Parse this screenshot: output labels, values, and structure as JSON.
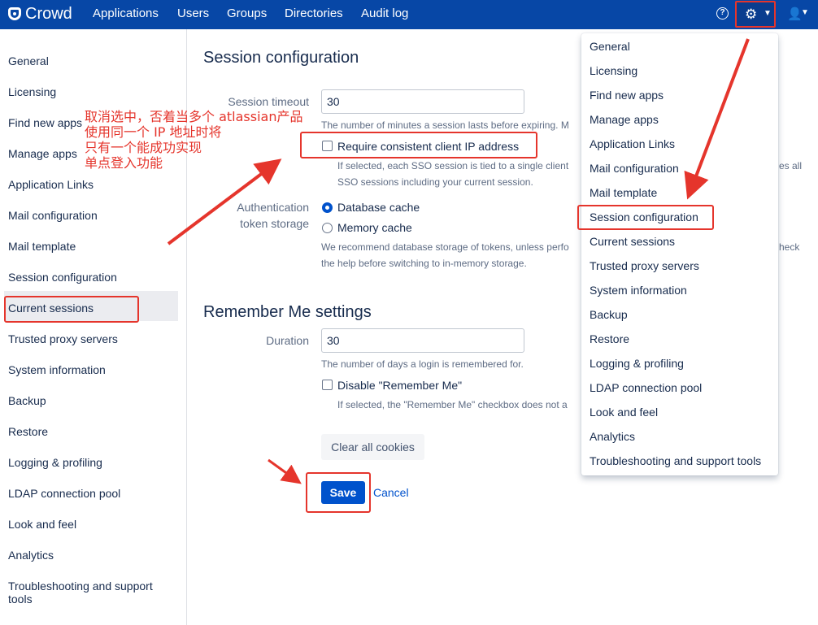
{
  "topnav": {
    "brand": "Crowd",
    "items": [
      "Applications",
      "Users",
      "Groups",
      "Directories",
      "Audit log"
    ],
    "help_glyph": "?",
    "icons": [
      "help-icon",
      "gear-icon",
      "user-icon"
    ]
  },
  "sidebar": {
    "items": [
      "General",
      "Licensing",
      "Find new apps",
      "Manage apps",
      "Application Links",
      "Mail configuration",
      "Mail template",
      "Session configuration",
      "Current sessions",
      "Trusted proxy servers",
      "System information",
      "Backup",
      "Restore",
      "Logging & profiling",
      "LDAP connection pool",
      "Look and feel",
      "Analytics",
      "Troubleshooting and support tools"
    ],
    "active": "Session configuration"
  },
  "session": {
    "title": "Session configuration",
    "timeout_label": "Session timeout",
    "timeout_value": "30",
    "timeout_help": "The number of minutes a session lasts before expiring. M",
    "ip_label": "Require consistent client IP address",
    "ip_help_1": "If selected, each SSO session is tied to a single client",
    "ip_help_1_tail": "es all",
    "ip_help_2": "SSO sessions including your current session.",
    "auth_label_1": "Authentication",
    "auth_label_2": "token storage",
    "opt_db": "Database cache",
    "opt_mem": "Memory cache",
    "storage_help_1": "We recommend database storage of tokens, unless perfo",
    "storage_help_1_tail": "heck",
    "storage_help_2": "the help before switching to in-memory storage."
  },
  "remember": {
    "title": "Remember Me settings",
    "duration_label": "Duration",
    "duration_value": "30",
    "duration_help": "The number of days a login is remembered for.",
    "disable_label": "Disable \"Remember Me\"",
    "disable_help": "If selected, the \"Remember Me\" checkbox does not a"
  },
  "actions": {
    "clear_cookies": "Clear all cookies",
    "save": "Save",
    "cancel": "Cancel"
  },
  "annotation": {
    "text": "取消选中，否着当多个 atlassian产品\n使用同一个 IP 地址时将\n只有一个能成功实现\n单点登入功能",
    "color": "#e5352c"
  },
  "dropdown": {
    "items": [
      "General",
      "Licensing",
      "Find new apps",
      "Manage apps",
      "Application Links",
      "Mail configuration",
      "Mail template",
      "Session configuration",
      "Current sessions",
      "Trusted proxy servers",
      "System information",
      "Backup",
      "Restore",
      "Logging & profiling",
      "LDAP connection pool",
      "Look and feel",
      "Analytics",
      "Troubleshooting and support tools"
    ],
    "highlighted": "Session configuration"
  },
  "colors": {
    "nav_bg": "#0747a6",
    "primary": "#0052cc",
    "annotation_red": "#e5352c"
  }
}
